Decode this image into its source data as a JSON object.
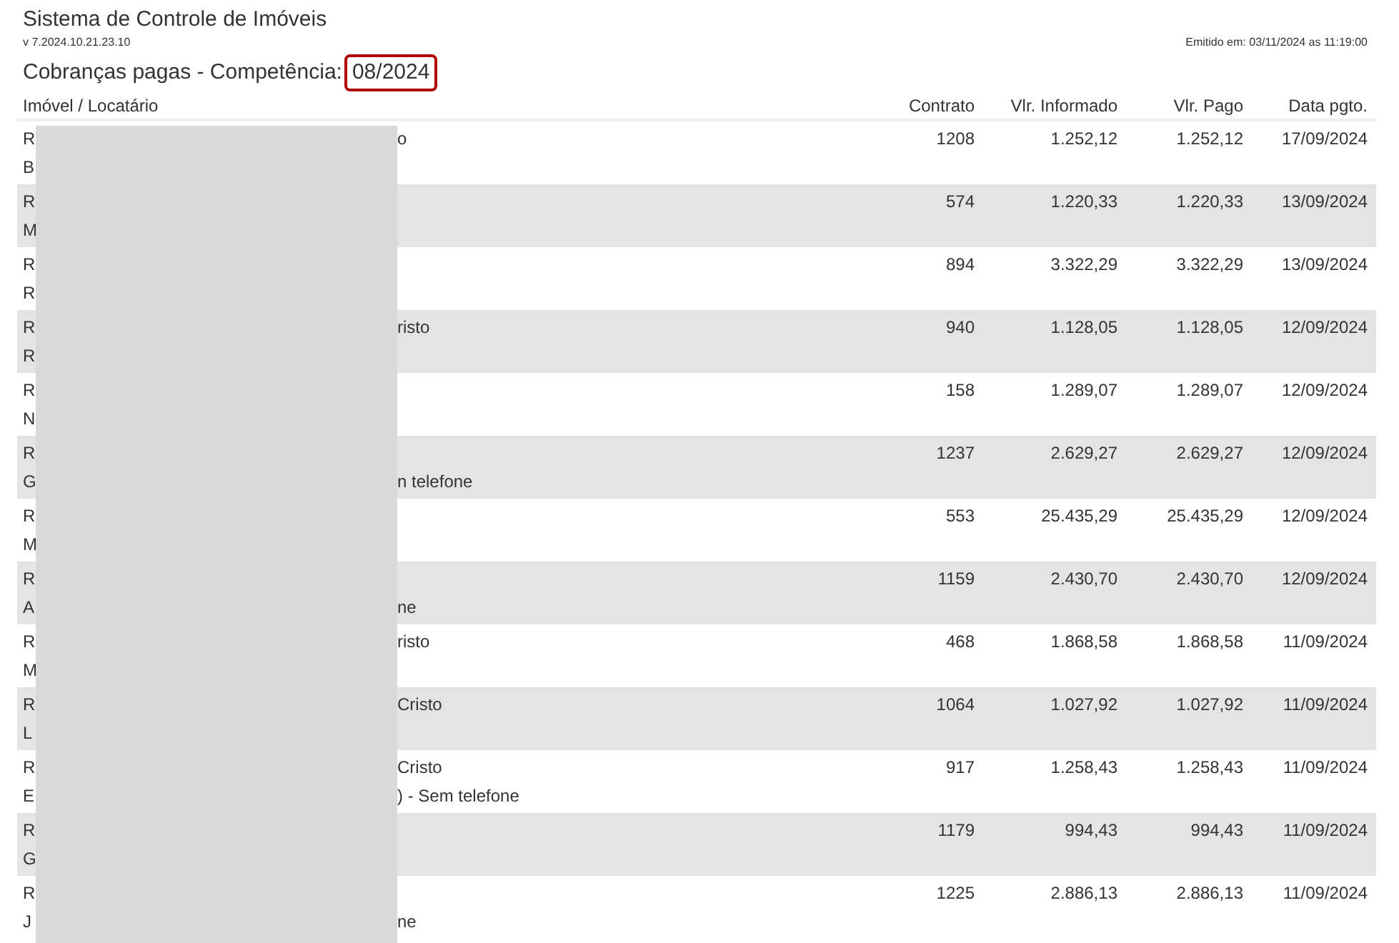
{
  "title": "Sistema de Controle de Imóveis",
  "version": "v 7.2024.10.21.23.10",
  "issued": "Emitido em: 03/11/2024 as 11:19:00",
  "report": {
    "label": "Cobranças pagas - Competência:",
    "period": "08/2024"
  },
  "columns": [
    "Imóvel / Locatário",
    "Contrato",
    "Vlr. Informado",
    "Vlr. Pago",
    "Data pgto."
  ],
  "rows": [
    {
      "address_start": "R",
      "address_end": "o",
      "tenant_start": "B",
      "contract": "1208",
      "informed": "1.252,12",
      "paid": "1.252,12",
      "date": "17/09/2024"
    },
    {
      "address_start": "R",
      "tenant_start": "M",
      "contract": "574",
      "informed": "1.220,33",
      "paid": "1.220,33",
      "date": "13/09/2024"
    },
    {
      "address_start": "R",
      "tenant_start": "R",
      "contract": "894",
      "informed": "3.322,29",
      "paid": "3.322,29",
      "date": "13/09/2024"
    },
    {
      "address_start": "R",
      "address_end": "risto",
      "tenant_start": "R",
      "contract": "940",
      "informed": "1.128,05",
      "paid": "1.128,05",
      "date": "12/09/2024"
    },
    {
      "address_start": "R",
      "tenant_start": "N",
      "contract": "158",
      "informed": "1.289,07",
      "paid": "1.289,07",
      "date": "12/09/2024"
    },
    {
      "address_start": "R",
      "tenant_start": "G",
      "tenant_end": "n telefone",
      "contract": "1237",
      "informed": "2.629,27",
      "paid": "2.629,27",
      "date": "12/09/2024"
    },
    {
      "address_start": "R",
      "tenant_start": "M",
      "contract": "553",
      "informed": "25.435,29",
      "paid": "25.435,29",
      "date": "12/09/2024"
    },
    {
      "address_start": "R",
      "tenant_start": "A",
      "tenant_end": "ne",
      "contract": "1159",
      "informed": "2.430,70",
      "paid": "2.430,70",
      "date": "12/09/2024"
    },
    {
      "address_start": "R",
      "address_end": "risto",
      "tenant_start": "M",
      "contract": "468",
      "informed": "1.868,58",
      "paid": "1.868,58",
      "date": "11/09/2024"
    },
    {
      "address_start": "R",
      "address_end": "Cristo",
      "tenant_start": "L",
      "contract": "1064",
      "informed": "1.027,92",
      "paid": "1.027,92",
      "date": "11/09/2024"
    },
    {
      "address_start": "R",
      "address_end": "Cristo",
      "tenant_start": "E",
      "tenant_end": ") - Sem telefone",
      "contract": "917",
      "informed": "1.258,43",
      "paid": "1.258,43",
      "date": "11/09/2024"
    },
    {
      "address_start": "R",
      "tenant_start": "G",
      "contract": "1179",
      "informed": "994,43",
      "paid": "994,43",
      "date": "11/09/2024"
    },
    {
      "address_start": "R",
      "tenant_start": "J",
      "tenant_end": "ne",
      "contract": "1225",
      "informed": "2.886,13",
      "paid": "2.886,13",
      "date": "11/09/2024"
    }
  ]
}
